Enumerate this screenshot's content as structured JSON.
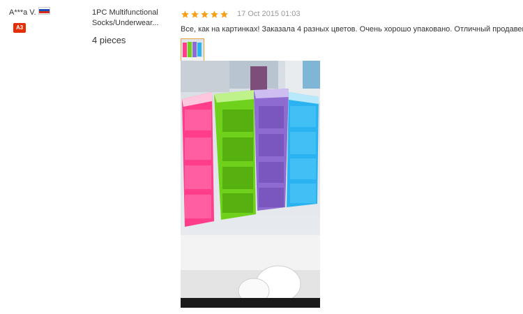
{
  "reviewer": {
    "name": "A***a V.",
    "flag_icon": "russia-flag-icon",
    "level": "A3",
    "level_color": "#e62e04"
  },
  "product": {
    "name_line1": "1PC Multifunctional",
    "name_line2": "Socks/Underwear...",
    "quantity": "4 pieces"
  },
  "review": {
    "rating": 5,
    "star_color": "#f7a01c",
    "date": "17 Oct 2015 01:03",
    "text": "Все, как на картинках! Заказала 4 разных цветов. Очень хорошо упаковано. Отличный продавец!"
  },
  "photos": {
    "thumbnail_icon": "photo-thumbnail",
    "main_icon": "review-photo-organizers"
  }
}
